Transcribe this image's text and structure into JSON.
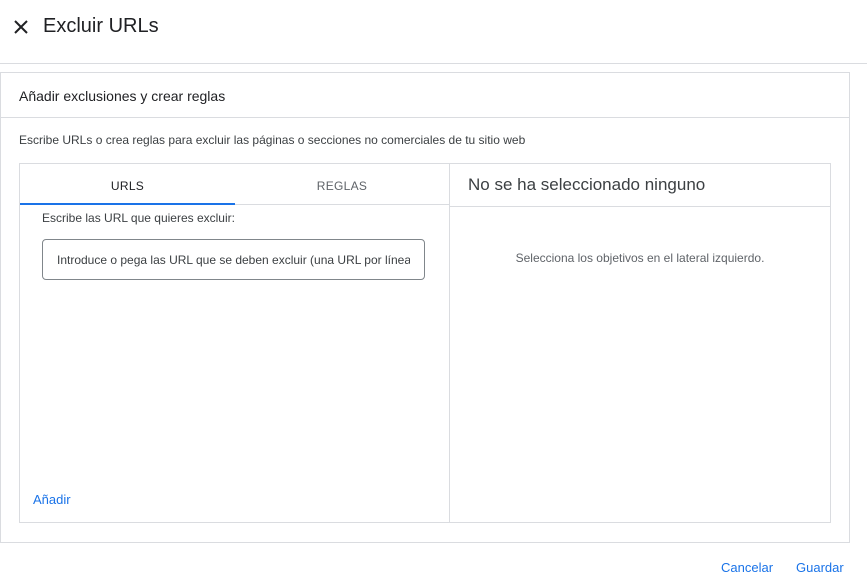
{
  "header": {
    "title": "Excluir URLs",
    "close_icon": "close-icon"
  },
  "card": {
    "title": "Añadir exclusiones y crear reglas",
    "description": "Escribe URLs o crea reglas para excluir las páginas o secciones no comerciales de tu sitio web"
  },
  "tabs": [
    {
      "label": "URLS",
      "selected": true
    },
    {
      "label": "REGLAS",
      "selected": false
    }
  ],
  "urls_tab": {
    "field_label": "Escribe las URL que quieres excluir:",
    "input_value": "",
    "input_placeholder": "Introduce o pega las URL que se deben excluir (una URL por línea)",
    "add_label": "Añadir"
  },
  "selection": {
    "title": "No se ha seleccionado ninguno",
    "empty_message": "Selecciona los objetivos en el lateral izquierdo."
  },
  "footer": {
    "cancel_label": "Cancelar",
    "save_label": "Guardar"
  },
  "colors": {
    "accent": "#1a73e8",
    "border": "#dadce0",
    "text": "#202124"
  }
}
